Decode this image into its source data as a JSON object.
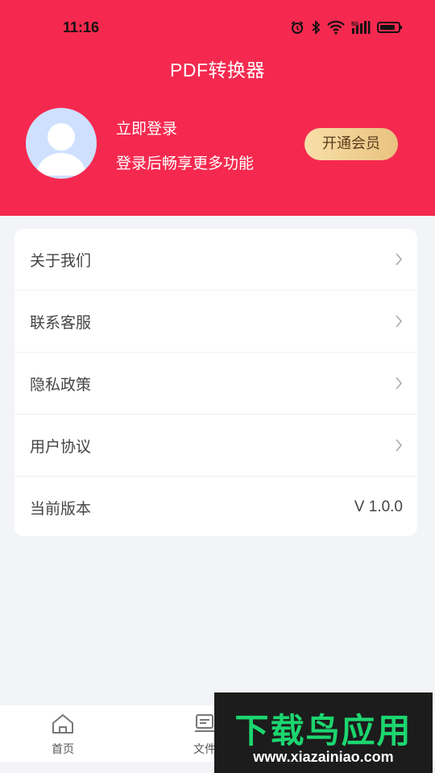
{
  "status_bar": {
    "time": "11:16",
    "icons": [
      "alarm-icon",
      "bluetooth-icon",
      "wifi-icon",
      "signal-icon",
      "battery-icon"
    ]
  },
  "header": {
    "title": "PDF转换器",
    "background_color": "#f5294f",
    "login_label": "立即登录",
    "login_subtitle": "登录后畅享更多功能",
    "vip_button_label": "开通会员"
  },
  "menu": {
    "items": [
      {
        "label": "关于我们",
        "icon": "chevron-right-icon"
      },
      {
        "label": "联系客服",
        "icon": "chevron-right-icon"
      },
      {
        "label": "隐私政策",
        "icon": "chevron-right-icon"
      },
      {
        "label": "用户协议",
        "icon": "chevron-right-icon"
      },
      {
        "label": "当前版本",
        "value": "V 1.0.0"
      }
    ]
  },
  "tabbar": {
    "tabs": [
      {
        "label": "首页",
        "icon": "home-icon"
      },
      {
        "label": "文件",
        "icon": "file-icon"
      }
    ]
  },
  "watermark": {
    "title": "下载鸟应用",
    "url": "www.xiazainiao.com"
  }
}
